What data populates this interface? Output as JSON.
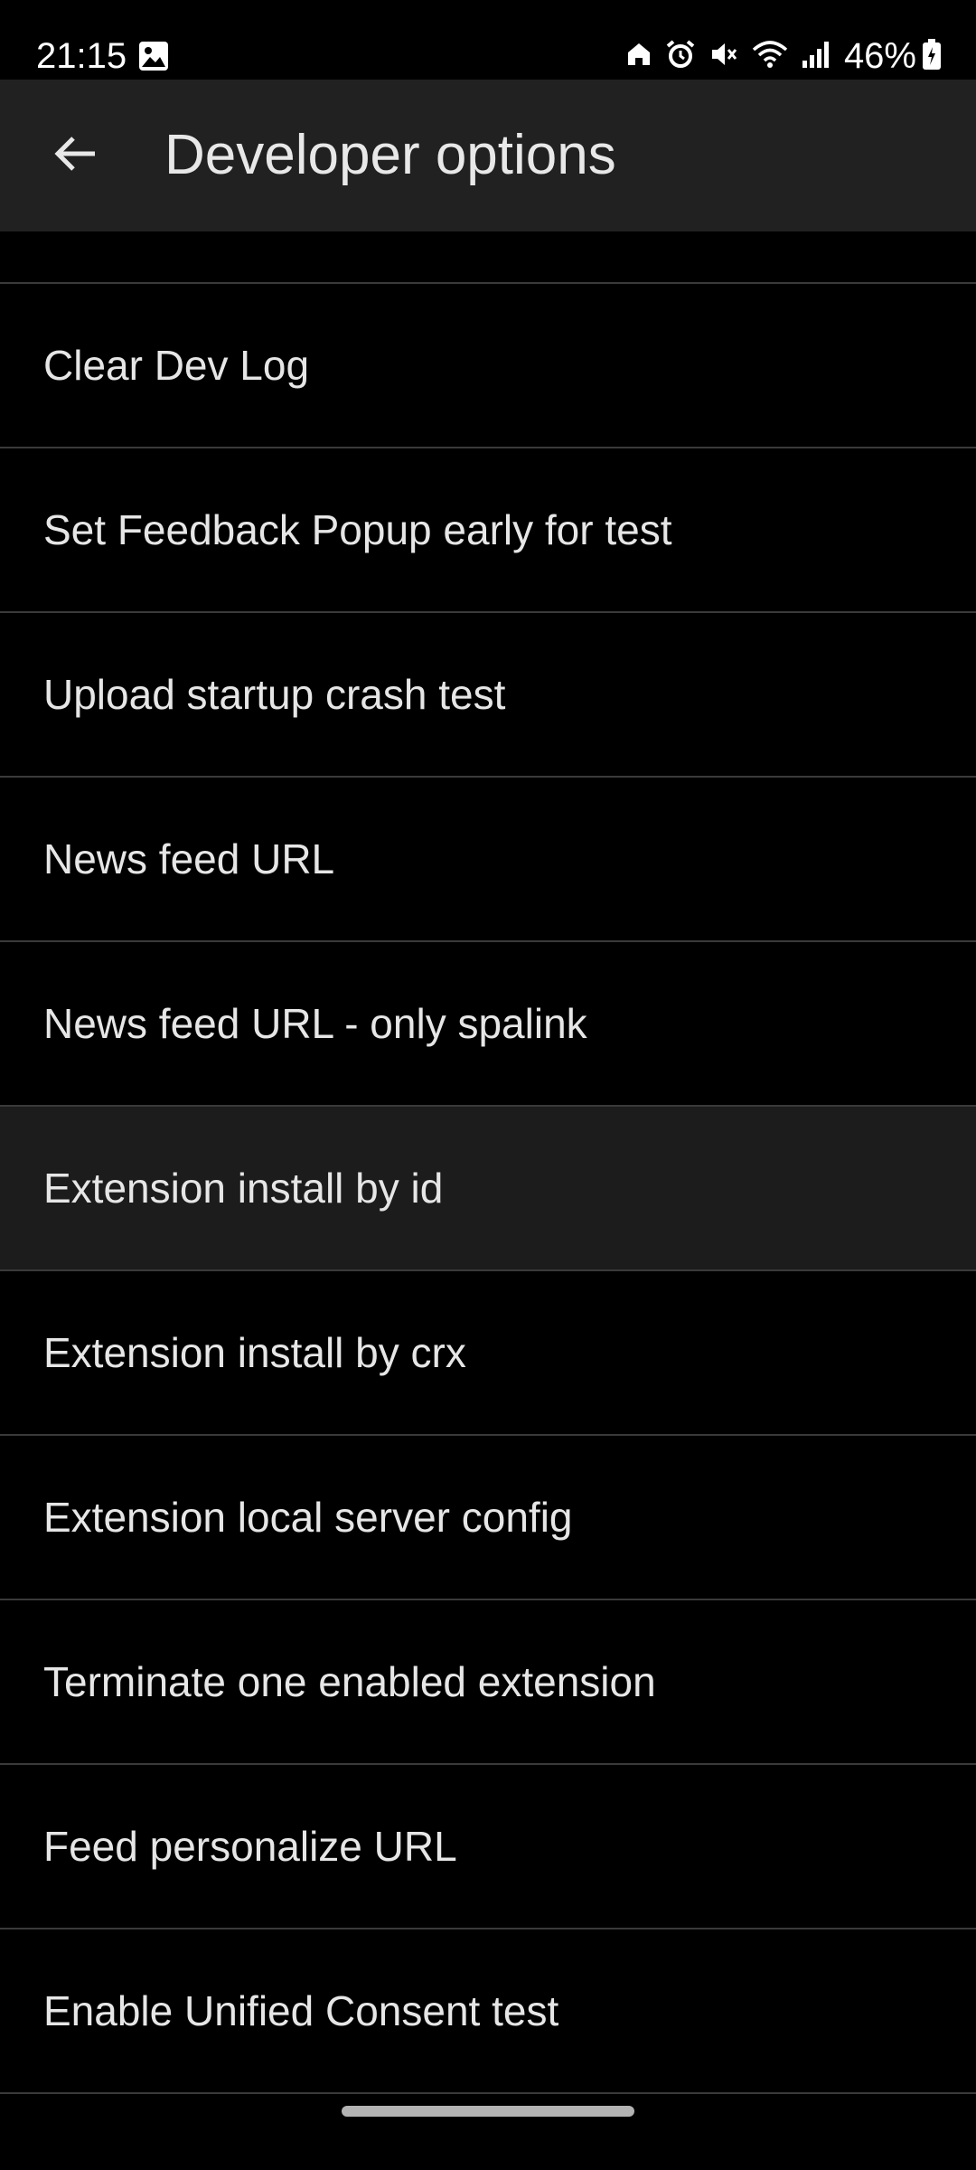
{
  "status_bar": {
    "time": "21:15",
    "battery_percent": "46%",
    "icons": [
      "gallery-icon",
      "home-icon",
      "alarm-icon",
      "mute-icon",
      "wifi-icon",
      "signal-icon",
      "battery-icon"
    ]
  },
  "toolbar": {
    "back_icon": "arrow-left-icon",
    "title": "Developer options",
    "background": "#212121"
  },
  "list": {
    "items": [
      {
        "label": "Clear Dev Log"
      },
      {
        "label": "Set Feedback Popup early for test"
      },
      {
        "label": "Upload startup crash test"
      },
      {
        "label": "News feed URL"
      },
      {
        "label": "News feed URL - only spalink"
      },
      {
        "label": "Extension install by id"
      },
      {
        "label": "Extension install by crx"
      },
      {
        "label": "Extension local server config"
      },
      {
        "label": "Terminate one enabled extension"
      },
      {
        "label": "Feed personalize URL"
      },
      {
        "label": "Enable Unified Consent test"
      }
    ],
    "highlighted_item": "Extension install by id",
    "divider_color": "#3a3a3a",
    "highlight_color": "#1c1c1c"
  }
}
